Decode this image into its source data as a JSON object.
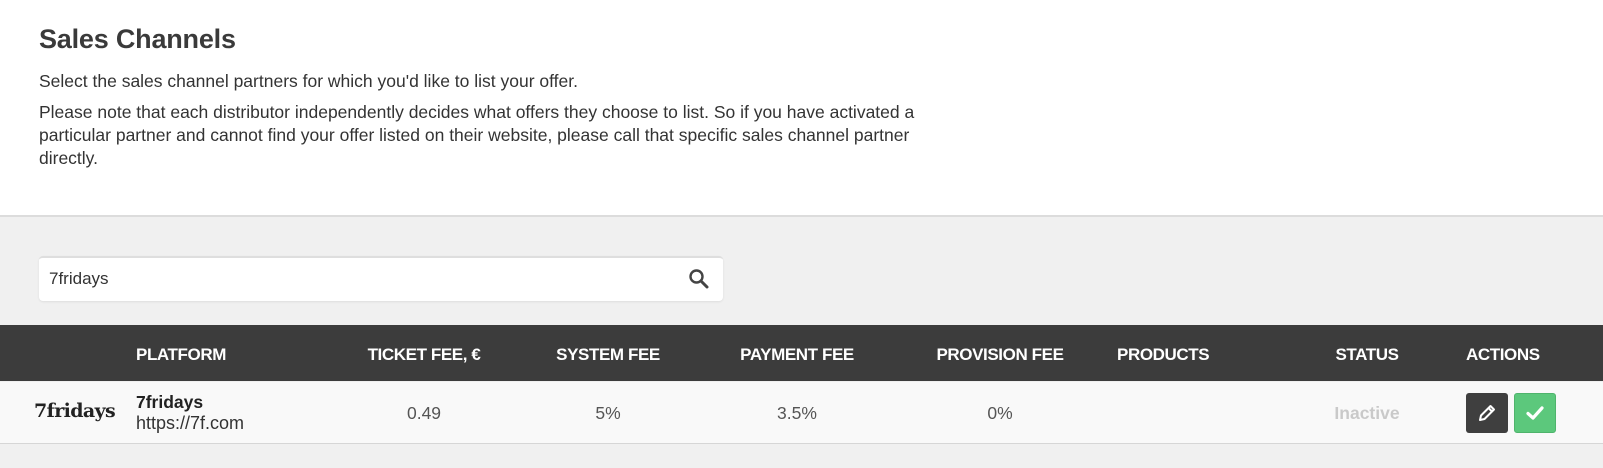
{
  "header": {
    "title": "Sales Channels",
    "intro": "Select the sales channel partners for which you'd like to list your offer.",
    "note": "Please note that each distributor independently decides what offers they choose to list. So if you have activated a particular partner and cannot find your offer listed on their website, please call that specific sales channel partner directly."
  },
  "search": {
    "value": "7fridays",
    "icon": "search-icon"
  },
  "table": {
    "columns": {
      "platform": "PLATFORM",
      "ticket_fee": "TICKET FEE, €",
      "system_fee": "SYSTEM FEE",
      "payment_fee": "PAYMENT FEE",
      "provision_fee": "PROVISION FEE",
      "products": "PRODUCTS",
      "status": "STATUS",
      "actions": "ACTIONS"
    },
    "rows": [
      {
        "logo_text": "7fridays",
        "name": "7fridays",
        "url": "https://7f.com",
        "ticket_fee": "0.49",
        "system_fee": "5%",
        "payment_fee": "3.5%",
        "provision_fee": "0%",
        "products": "",
        "status": "Inactive",
        "actions": [
          "edit-icon",
          "check-icon"
        ]
      }
    ]
  },
  "colors": {
    "table_header_bg": "#3c3c3c",
    "edit_button_bg": "#3f3f3f",
    "activate_button_bg": "#5cc87c",
    "status_inactive": "#c9c9c9"
  }
}
